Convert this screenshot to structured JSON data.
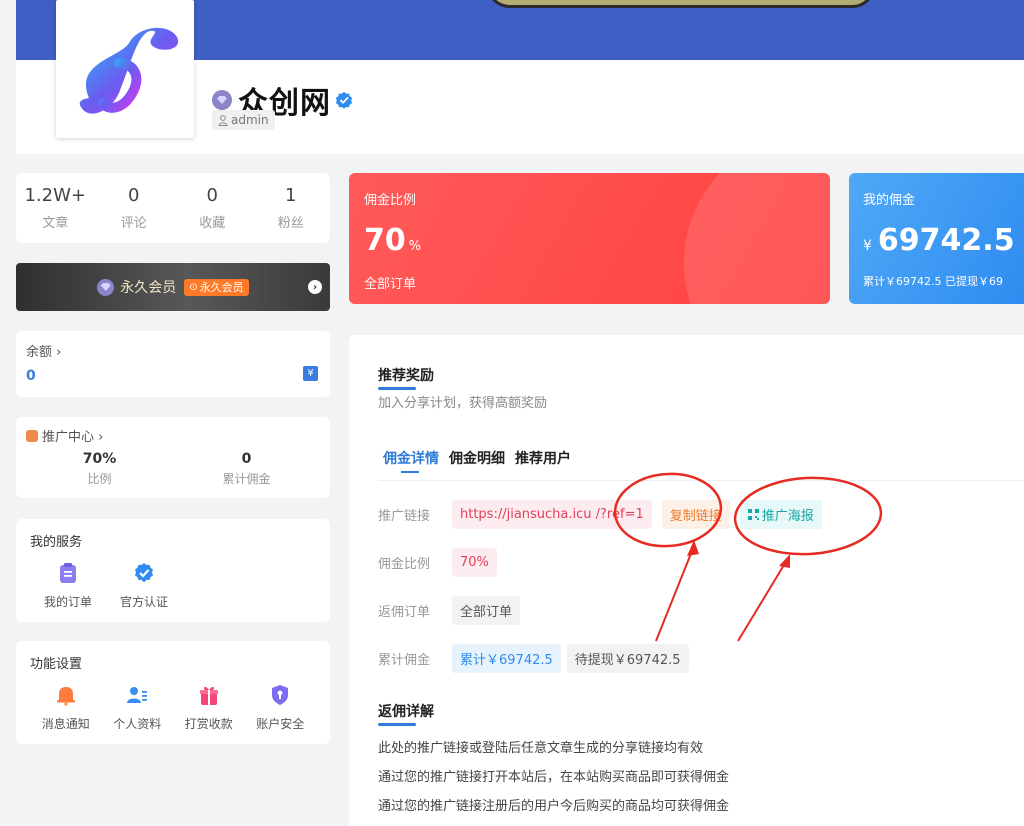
{
  "profile": {
    "site_name": "众创网",
    "username": "admin"
  },
  "stats": [
    {
      "value": "1.2W+",
      "label": "文章"
    },
    {
      "value": "0",
      "label": "评论"
    },
    {
      "value": "0",
      "label": "收藏"
    },
    {
      "value": "1",
      "label": "粉丝"
    }
  ],
  "vip": {
    "label": "永久会员",
    "badge": "永久会员",
    "badge_icon": "gear-icon"
  },
  "balance": {
    "title": "余额 ›",
    "value": "0",
    "icon": "yen-card-icon",
    "icon_text": "¥"
  },
  "promo": {
    "title": "推广中心 ›",
    "items": [
      {
        "value": "70%",
        "label": "比例"
      },
      {
        "value": "0",
        "label": "累计佣金"
      }
    ]
  },
  "services": {
    "title": "我的服务",
    "items": [
      {
        "label": "我的订单",
        "icon": "clipboard-icon"
      },
      {
        "label": "官方认证",
        "icon": "verified-icon"
      }
    ]
  },
  "settings": {
    "title": "功能设置",
    "items": [
      {
        "label": "消息通知",
        "icon": "bell-icon"
      },
      {
        "label": "个人资料",
        "icon": "user-card-icon"
      },
      {
        "label": "打赏收款",
        "icon": "gift-icon"
      },
      {
        "label": "账户安全",
        "icon": "shield-icon"
      }
    ]
  },
  "rate_card": {
    "title": "佣金比例",
    "value": "70",
    "unit": "%",
    "footer": "全部订单",
    "color": "#ff4d4d"
  },
  "commission_card": {
    "title": "我的佣金",
    "currency": "¥",
    "value": "69742.5",
    "footer": "累计￥69742.5   已提现￥69",
    "color": "#3a95f2"
  },
  "main": {
    "section_title": "推荐奖励",
    "section_sub": "加入分享计划，获得高额奖励",
    "tabs": [
      "佣金详情",
      "佣金明细",
      "推荐用户"
    ],
    "active_tab": 0,
    "rows": {
      "link_label": "推广链接",
      "link_value": "https://jiansucha.icu /?ref=1",
      "copy_label": "复制链接",
      "poster_label": "推广海报",
      "rate_label": "佣金比例",
      "rate_value": "70%",
      "order_label": "返佣订单",
      "order_value": "全部订单",
      "total_label": "累计佣金",
      "total_value": "累计￥69742.5",
      "pending_value": "待提现￥69742.5"
    },
    "detail_title": "返佣详解",
    "detail_lines": [
      "此处的推广链接或登陆后任意文章生成的分享链接均有效",
      "通过您的推广链接打开本站后，在本站购买商品即可获得佣金",
      "通过您的推广链接注册后的用户今后购买的商品均可获得佣金"
    ]
  },
  "colors": {
    "accent": "#2f7bd8",
    "banner": "#3f5fc4",
    "annotation_red": "#e52b22"
  }
}
